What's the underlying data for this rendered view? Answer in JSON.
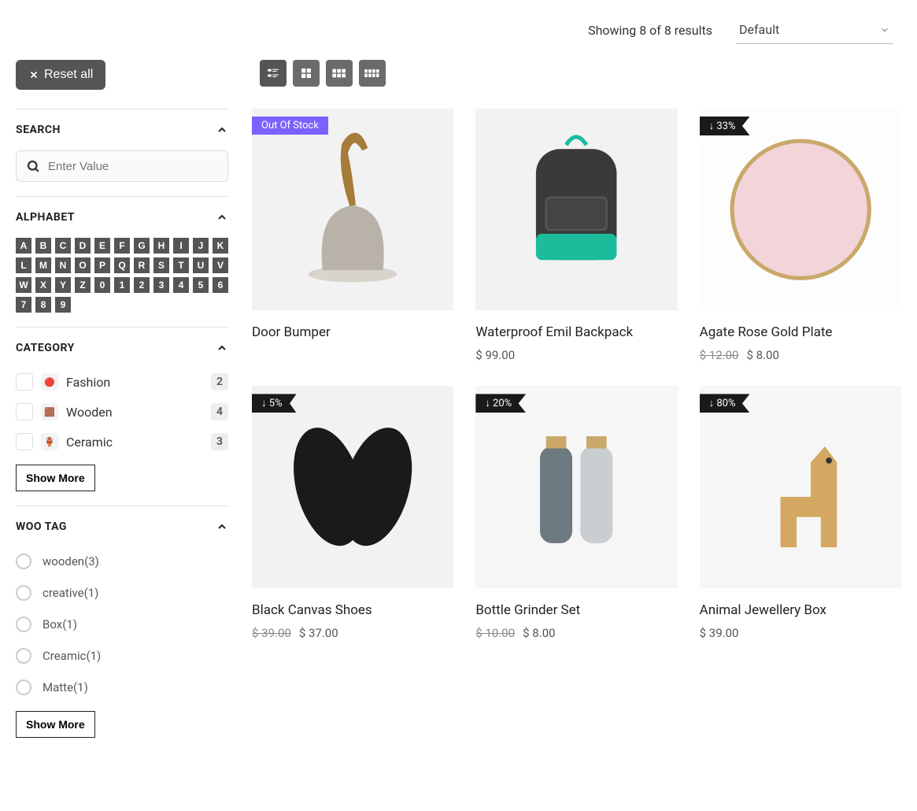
{
  "header": {
    "results_text": "Showing 8 of 8 results",
    "sort_selected": "Default"
  },
  "reset_label": "Reset all",
  "filters": {
    "search": {
      "title": "SEARCH",
      "placeholder": "Enter Value"
    },
    "alphabet": {
      "title": "ALPHABET",
      "keys": [
        "A",
        "B",
        "C",
        "D",
        "E",
        "F",
        "G",
        "H",
        "I",
        "J",
        "K",
        "L",
        "M",
        "N",
        "O",
        "P",
        "Q",
        "R",
        "S",
        "T",
        "U",
        "V",
        "W",
        "X",
        "Y",
        "Z",
        "0",
        "1",
        "2",
        "3",
        "4",
        "5",
        "6",
        "7",
        "8",
        "9"
      ]
    },
    "category": {
      "title": "CATEGORY",
      "items": [
        {
          "label": "Fashion",
          "count": "2"
        },
        {
          "label": "Wooden",
          "count": "4"
        },
        {
          "label": "Ceramic",
          "count": "3"
        }
      ],
      "show_more": "Show More"
    },
    "tag": {
      "title": "WOO TAG",
      "items": [
        {
          "label": "wooden",
          "count": "3"
        },
        {
          "label": "creative",
          "count": "1"
        },
        {
          "label": "Box",
          "count": "1"
        },
        {
          "label": "Creamic",
          "count": "1"
        },
        {
          "label": "Matte",
          "count": "1"
        }
      ],
      "show_more": "Show More"
    }
  },
  "products": [
    {
      "title": "Door Bumper",
      "badge_type": "oos",
      "badge_text": "Out Of Stock",
      "price": "",
      "old_price": "",
      "currency": ""
    },
    {
      "title": "Waterproof Emil Backpack",
      "badge_type": "",
      "badge_text": "",
      "price": "99.00",
      "old_price": "",
      "currency": "$"
    },
    {
      "title": "Agate Rose Gold Plate",
      "badge_type": "disc",
      "badge_text": "↓ 33%",
      "price": "8.00",
      "old_price": "12.00",
      "currency": "$"
    },
    {
      "title": "Black Canvas Shoes",
      "badge_type": "disc",
      "badge_text": "↓ 5%",
      "price": "37.00",
      "old_price": "39.00",
      "currency": "$"
    },
    {
      "title": "Bottle Grinder Set",
      "badge_type": "disc",
      "badge_text": "↓ 20%",
      "price": "8.00",
      "old_price": "10.00",
      "currency": "$"
    },
    {
      "title": "Animal Jewellery Box",
      "badge_type": "disc",
      "badge_text": "↓ 80%",
      "price": "39.00",
      "old_price": "",
      "currency": "$"
    }
  ]
}
